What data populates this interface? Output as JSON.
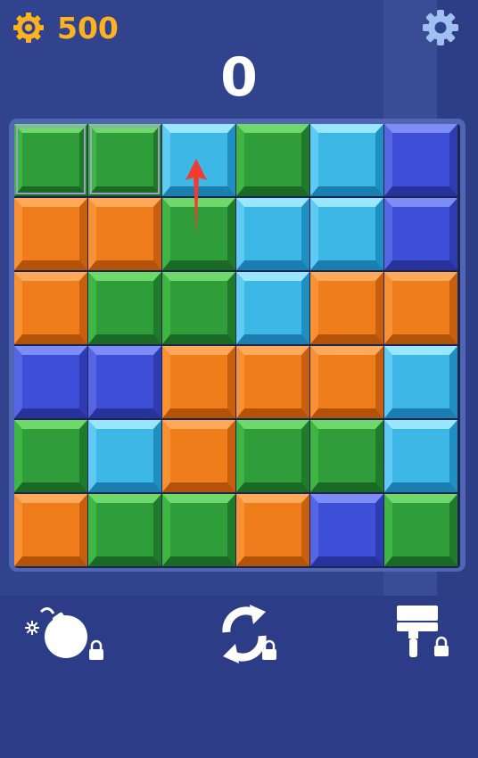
{
  "header": {
    "coins": "500",
    "score": "0",
    "coin_icon": "gear-coin-icon",
    "settings_icon": "gear-icon"
  },
  "colors": {
    "green": "#2f9e3a",
    "cyan": "#3cb7e6",
    "blue": "#3d4fd6",
    "orange": "#f07d1c",
    "background": "#32438d",
    "coin": "#ffb21f"
  },
  "board": {
    "rows": 6,
    "cols": 6,
    "grid": [
      [
        "green",
        "green",
        "cyan",
        "green",
        "cyan",
        "blue"
      ],
      [
        "orange",
        "orange",
        "green",
        "cyan",
        "cyan",
        "blue"
      ],
      [
        "orange",
        "green",
        "green",
        "cyan",
        "orange",
        "orange"
      ],
      [
        "blue",
        "blue",
        "orange",
        "orange",
        "orange",
        "cyan"
      ],
      [
        "green",
        "cyan",
        "orange",
        "green",
        "green",
        "cyan"
      ],
      [
        "orange",
        "green",
        "green",
        "orange",
        "blue",
        "green"
      ]
    ],
    "selected": [
      [
        0,
        0
      ],
      [
        0,
        1
      ]
    ],
    "hint": {
      "from": [
        1,
        2
      ],
      "to": [
        0,
        2
      ],
      "icon": "red-arrow-up-icon"
    }
  },
  "powerups": [
    {
      "name": "bomb",
      "icon": "bomb-icon",
      "locked": true
    },
    {
      "name": "shuffle",
      "icon": "shuffle-icon",
      "locked": true
    },
    {
      "name": "paint",
      "icon": "paint-roller-icon",
      "locked": true
    }
  ]
}
